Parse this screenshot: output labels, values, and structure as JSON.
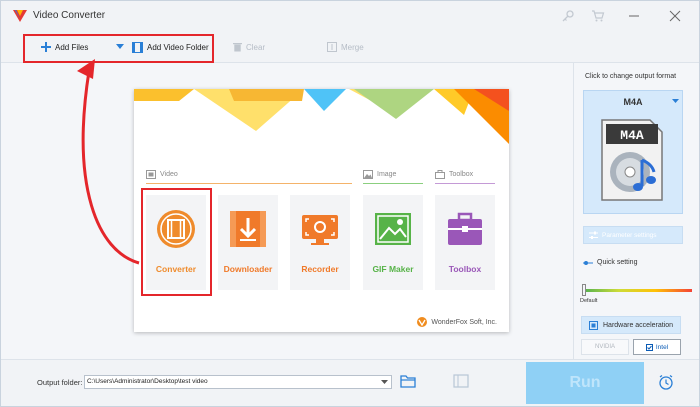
{
  "window": {
    "title": "Video Converter"
  },
  "toolbar": {
    "add_files": "Add Files",
    "add_video_folder": "Add Video Folder",
    "clear": "Clear",
    "merge": "Merge"
  },
  "panel": {
    "sections": {
      "video": "Video",
      "image": "Image",
      "toolbox": "Toolbox"
    },
    "tools": [
      {
        "label": "Converter",
        "color": "#ef8b2c"
      },
      {
        "label": "Downloader",
        "color": "#f07a2a"
      },
      {
        "label": "Recorder",
        "color": "#f07a2a"
      },
      {
        "label": "GIF Maker",
        "color": "#57b348"
      },
      {
        "label": "Toolbox",
        "color": "#9a57b8"
      }
    ],
    "brand": "WonderFox Soft, Inc."
  },
  "format_panel": {
    "hint": "Click to change output format",
    "format": "M4A",
    "icon_text": "M4A",
    "parameter_settings": "Parameter settings",
    "quick_setting": "Quick setting",
    "default": "Default",
    "hardware_acceleration": "Hardware acceleration",
    "nvidia": "NVIDIA",
    "intel": "Intel"
  },
  "bottom": {
    "output_folder_label": "Output folder:",
    "output_path": "C:\\Users\\Administrator\\Desktop\\test video",
    "run": "Run"
  },
  "colors": {
    "accent": "#2a7fd6",
    "highlight_red": "#e4262b",
    "run_button": "#8fd0f5"
  }
}
